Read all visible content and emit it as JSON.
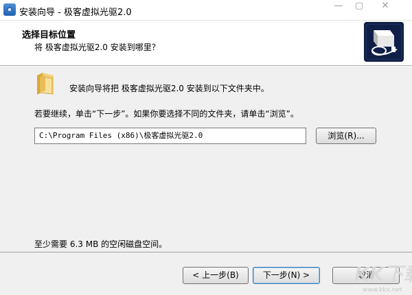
{
  "window": {
    "title": "安装向导 - 极客虚拟光驱2.0",
    "min_glyph": "—",
    "max_glyph": "▢",
    "close_glyph": "✕"
  },
  "header": {
    "title": "选择目标位置",
    "subtitle": "将 极客虚拟光驱2.0 安装到哪里？"
  },
  "main": {
    "intro": "安装向导将把 极客虚拟光驱2.0 安装到以下文件夹中。",
    "hint": "若要继续，单击“下一步”。如果你要选择不同的文件夹，请单击“浏览”。",
    "path_value": "C:\\Program Files (x86)\\极客虚拟光驱2.0",
    "browse_label": "浏览(R)...",
    "space_required": "至少需要 6.3 MB 的空闲磁盘空间。"
  },
  "footer": {
    "back_label": "< 上一步(B)",
    "next_label": "下一步(N) >",
    "cancel_label": "取消"
  },
  "watermark": {
    "text": "KK下载",
    "url": "www.kkx.net"
  },
  "colors": {
    "body_bg": "#f0f0f0",
    "header_bg": "#ffffff",
    "logo_bg": "#0d1b3d",
    "default_button_border": "#3c7fb1"
  },
  "icons": [
    "app-icon",
    "folder-icon",
    "installer-logo-icon"
  ]
}
